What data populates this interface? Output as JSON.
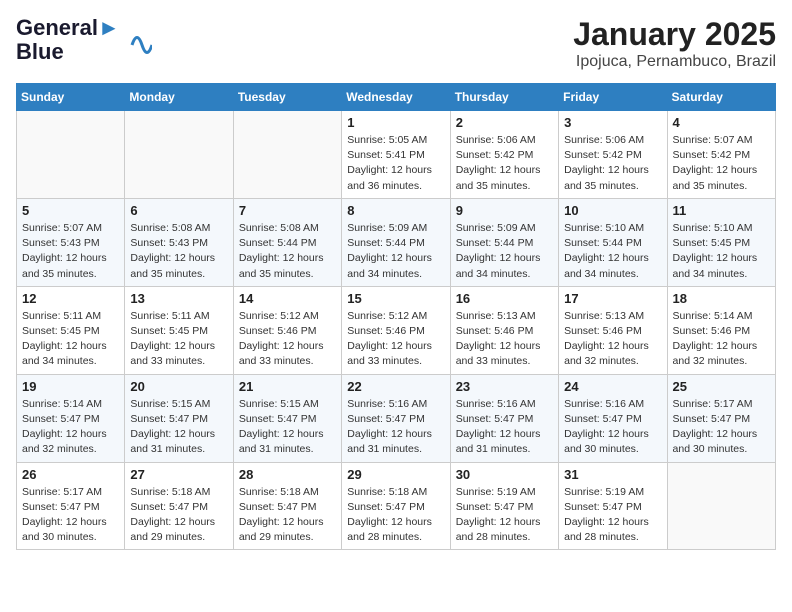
{
  "logo": {
    "line1": "General",
    "line2": "Blue"
  },
  "title": "January 2025",
  "subtitle": "Ipojuca, Pernambuco, Brazil",
  "weekdays": [
    "Sunday",
    "Monday",
    "Tuesday",
    "Wednesday",
    "Thursday",
    "Friday",
    "Saturday"
  ],
  "weeks": [
    [
      {
        "day": "",
        "info": ""
      },
      {
        "day": "",
        "info": ""
      },
      {
        "day": "",
        "info": ""
      },
      {
        "day": "1",
        "info": "Sunrise: 5:05 AM\nSunset: 5:41 PM\nDaylight: 12 hours\nand 36 minutes."
      },
      {
        "day": "2",
        "info": "Sunrise: 5:06 AM\nSunset: 5:42 PM\nDaylight: 12 hours\nand 35 minutes."
      },
      {
        "day": "3",
        "info": "Sunrise: 5:06 AM\nSunset: 5:42 PM\nDaylight: 12 hours\nand 35 minutes."
      },
      {
        "day": "4",
        "info": "Sunrise: 5:07 AM\nSunset: 5:42 PM\nDaylight: 12 hours\nand 35 minutes."
      }
    ],
    [
      {
        "day": "5",
        "info": "Sunrise: 5:07 AM\nSunset: 5:43 PM\nDaylight: 12 hours\nand 35 minutes."
      },
      {
        "day": "6",
        "info": "Sunrise: 5:08 AM\nSunset: 5:43 PM\nDaylight: 12 hours\nand 35 minutes."
      },
      {
        "day": "7",
        "info": "Sunrise: 5:08 AM\nSunset: 5:44 PM\nDaylight: 12 hours\nand 35 minutes."
      },
      {
        "day": "8",
        "info": "Sunrise: 5:09 AM\nSunset: 5:44 PM\nDaylight: 12 hours\nand 34 minutes."
      },
      {
        "day": "9",
        "info": "Sunrise: 5:09 AM\nSunset: 5:44 PM\nDaylight: 12 hours\nand 34 minutes."
      },
      {
        "day": "10",
        "info": "Sunrise: 5:10 AM\nSunset: 5:44 PM\nDaylight: 12 hours\nand 34 minutes."
      },
      {
        "day": "11",
        "info": "Sunrise: 5:10 AM\nSunset: 5:45 PM\nDaylight: 12 hours\nand 34 minutes."
      }
    ],
    [
      {
        "day": "12",
        "info": "Sunrise: 5:11 AM\nSunset: 5:45 PM\nDaylight: 12 hours\nand 34 minutes."
      },
      {
        "day": "13",
        "info": "Sunrise: 5:11 AM\nSunset: 5:45 PM\nDaylight: 12 hours\nand 33 minutes."
      },
      {
        "day": "14",
        "info": "Sunrise: 5:12 AM\nSunset: 5:46 PM\nDaylight: 12 hours\nand 33 minutes."
      },
      {
        "day": "15",
        "info": "Sunrise: 5:12 AM\nSunset: 5:46 PM\nDaylight: 12 hours\nand 33 minutes."
      },
      {
        "day": "16",
        "info": "Sunrise: 5:13 AM\nSunset: 5:46 PM\nDaylight: 12 hours\nand 33 minutes."
      },
      {
        "day": "17",
        "info": "Sunrise: 5:13 AM\nSunset: 5:46 PM\nDaylight: 12 hours\nand 32 minutes."
      },
      {
        "day": "18",
        "info": "Sunrise: 5:14 AM\nSunset: 5:46 PM\nDaylight: 12 hours\nand 32 minutes."
      }
    ],
    [
      {
        "day": "19",
        "info": "Sunrise: 5:14 AM\nSunset: 5:47 PM\nDaylight: 12 hours\nand 32 minutes."
      },
      {
        "day": "20",
        "info": "Sunrise: 5:15 AM\nSunset: 5:47 PM\nDaylight: 12 hours\nand 31 minutes."
      },
      {
        "day": "21",
        "info": "Sunrise: 5:15 AM\nSunset: 5:47 PM\nDaylight: 12 hours\nand 31 minutes."
      },
      {
        "day": "22",
        "info": "Sunrise: 5:16 AM\nSunset: 5:47 PM\nDaylight: 12 hours\nand 31 minutes."
      },
      {
        "day": "23",
        "info": "Sunrise: 5:16 AM\nSunset: 5:47 PM\nDaylight: 12 hours\nand 31 minutes."
      },
      {
        "day": "24",
        "info": "Sunrise: 5:16 AM\nSunset: 5:47 PM\nDaylight: 12 hours\nand 30 minutes."
      },
      {
        "day": "25",
        "info": "Sunrise: 5:17 AM\nSunset: 5:47 PM\nDaylight: 12 hours\nand 30 minutes."
      }
    ],
    [
      {
        "day": "26",
        "info": "Sunrise: 5:17 AM\nSunset: 5:47 PM\nDaylight: 12 hours\nand 30 minutes."
      },
      {
        "day": "27",
        "info": "Sunrise: 5:18 AM\nSunset: 5:47 PM\nDaylight: 12 hours\nand 29 minutes."
      },
      {
        "day": "28",
        "info": "Sunrise: 5:18 AM\nSunset: 5:47 PM\nDaylight: 12 hours\nand 29 minutes."
      },
      {
        "day": "29",
        "info": "Sunrise: 5:18 AM\nSunset: 5:47 PM\nDaylight: 12 hours\nand 28 minutes."
      },
      {
        "day": "30",
        "info": "Sunrise: 5:19 AM\nSunset: 5:47 PM\nDaylight: 12 hours\nand 28 minutes."
      },
      {
        "day": "31",
        "info": "Sunrise: 5:19 AM\nSunset: 5:47 PM\nDaylight: 12 hours\nand 28 minutes."
      },
      {
        "day": "",
        "info": ""
      }
    ]
  ]
}
